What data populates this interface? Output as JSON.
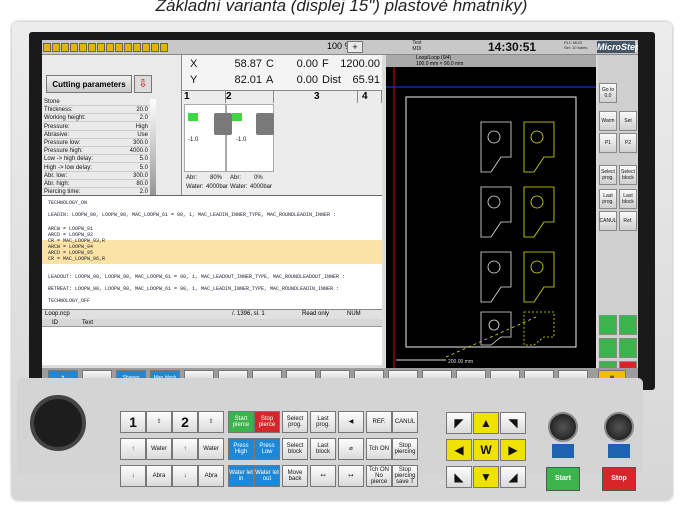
{
  "caption": "Základní varianta (displej 15\") plastové hmatníky)",
  "toolbar": {
    "zoom": "100 %",
    "clock": "14:30:51",
    "logo": "MicroStep",
    "mode_line1": "Test",
    "mode_line2": "MDI",
    "state_line1": "PLC MOS",
    "state_line2": "Sel: 10 tubes"
  },
  "params": {
    "button": "Cutting parameters",
    "rows": [
      {
        "label": "Stone",
        "value": ""
      },
      {
        "label": "Thickness:",
        "value": "20.0"
      },
      {
        "label": "Working height:",
        "value": "2.0"
      },
      {
        "label": "Pressure:",
        "value": "High"
      },
      {
        "label": "Abrasive:",
        "value": "Use"
      },
      {
        "label": "Pressure low:",
        "value": "300.0"
      },
      {
        "label": "Pressure high:",
        "value": "4000.0"
      },
      {
        "label": "Low -> high delay:",
        "value": "5.0"
      },
      {
        "label": "High -> low delay:",
        "value": "5.0"
      },
      {
        "label": "Abr. low:",
        "value": "300.0"
      },
      {
        "label": "Abr. high:",
        "value": "80.0"
      },
      {
        "label": "Piercing time:",
        "value": "2.0"
      },
      {
        "label": "F:",
        "value": "1200.0"
      }
    ]
  },
  "axes": {
    "x_label": "X",
    "x_val": "58.87",
    "c_label": "C",
    "c_val": "0.00",
    "f_label": "F",
    "f_val": "1200.00",
    "y_label": "Y",
    "y_val": "82.01",
    "a_label": "A",
    "a_val": "0.00",
    "dist_label": "Dist",
    "dist_val": "65.91"
  },
  "heads": {
    "h1": "1",
    "h2": "2",
    "h3": "3",
    "h4": "4",
    "abr1": "80%",
    "abr2": "0%",
    "water1": "4000bar",
    "water2": "4000bar",
    "abr_label": "Abr:",
    "water_label": "Water:",
    "minus1": "-1.0",
    "minus2": "-1.0"
  },
  "code": [
    "TECHNOLOGY_ON",
    "LEADIN: LOOPW_90, LOOPW_90, MAC_LOOPW_61 = 90, 1, MAC_LEADIN_INNER_TYPE, MAC_ROUNDLEADIN_INNER :",
    "ARCW = LOOPW_91",
    "ARCD = LOOPW_92",
    "CR = MAC_LOOPW_93,R",
    "ARCW = LOOPW_94",
    "ARCD = LOOPW_95",
    "CR = MAC_LOOPW_96,R",
    "LEADOUT: LOOPW_90, LOOPW_90, MAC_LOOPW_61 = 90, 1, MAC_LEADOUT_INNER_TYPE, MAC_ROUNDLEADOUT_INNER :",
    "RETREAT: LOOPW_90, LOOPW_90, MAC_LOOPW_61 = 90, 1, MAC_LEADIN_INNER_TYPE, MAC_ROUNDLEADIN_INNER :",
    "TECHNOLOGY_OFF",
    "*PIECE 0706WC_00476",
    "*CONTOUR 000008-08"
  ],
  "status": {
    "file": "Loop.ncp",
    "pos": "/. 1396, sl. 1",
    "mode": "Read only",
    "num": "NUM"
  },
  "list": {
    "col_id": "ID",
    "col_text": "Text"
  },
  "gfx": {
    "scale": "200.00 mm",
    "hdr1": "Loop/Loop (0/4)",
    "hdr2": "100.0 mm × 90.0 mm"
  },
  "rightkeys": [
    "Go to 0,0",
    "Warm",
    "Set",
    "P1",
    "P2",
    "Select prog.",
    "Select block",
    "Last prog.",
    "Last block",
    "CANUL",
    "Ref."
  ],
  "bottomkeys": [
    "Shapes",
    "Man block"
  ],
  "keypad": {
    "water": "Water",
    "abra": "Abra",
    "start": "Start",
    "stop": "Stop",
    "start_pierce": "Start pierce",
    "stop_pierce": "Stop pierce",
    "select_prog": "Select prog.",
    "last_prog": "Last prog.",
    "select_block": "Select block",
    "last_block": "Last block",
    "press_high": "Press High",
    "press_low": "Press Low",
    "water_in": "Water let in",
    "water_out": "Water let out",
    "move_back": "Move back",
    "ref": "REF.",
    "canul": "CANUL",
    "tch_on": "Tch ON",
    "tch_on_np": "Tch ON No pierce",
    "stop_pierc": "Stop piercing",
    "stop_pierc_save": "Stop piercing save T",
    "n1": "1",
    "n2": "2",
    "W": "W"
  }
}
